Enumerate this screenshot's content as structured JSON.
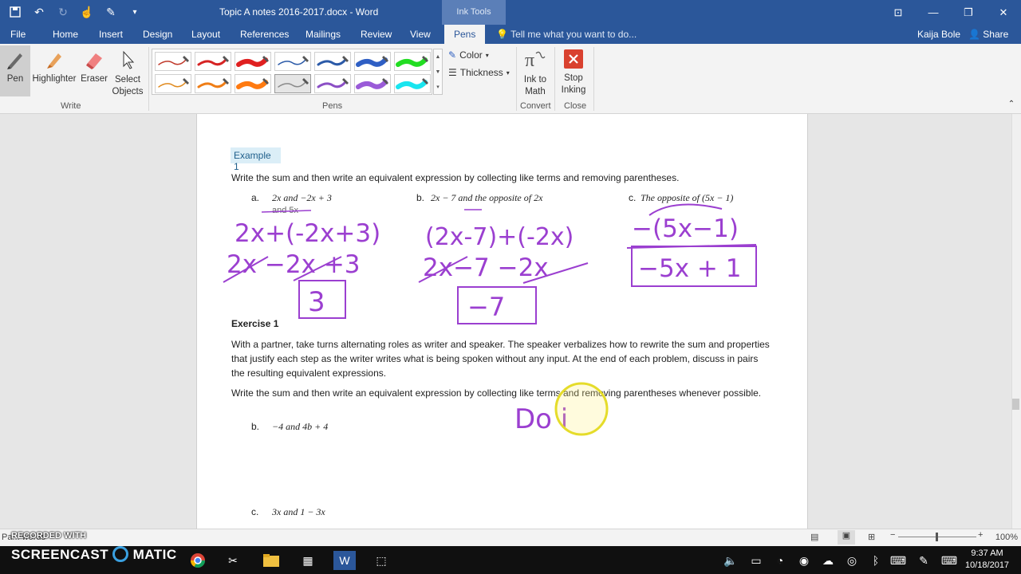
{
  "window": {
    "title": "Topic A notes 2016-2017.docx - Word",
    "ink_tools_label": "Ink Tools",
    "controls": [
      "⊡",
      "—",
      "❐",
      "✕"
    ]
  },
  "ribbon_tabs": [
    "File",
    "Home",
    "Insert",
    "Design",
    "Layout",
    "References",
    "Mailings",
    "Review",
    "View",
    "Pens"
  ],
  "active_tab": "Pens",
  "tell_me": "Tell me what you want to do...",
  "user_name": "Kaija Bole",
  "share_label": "Share",
  "ribbon": {
    "write_group": {
      "label": "Write",
      "pen": "Pen",
      "highlighter": "Highlighter",
      "eraser": "Eraser",
      "select_objects_1": "Select",
      "select_objects_2": "Objects"
    },
    "pens_group": {
      "label": "Pens",
      "row1_colors": [
        "#c0392b",
        "#d62424",
        "#e02020",
        "#2b5aa8",
        "#2b5aa8",
        "#2f5fc4",
        "#22dd22"
      ],
      "row2_colors": [
        "#e08a1e",
        "#ef7d16",
        "#ff7a10",
        "#8a8a8a",
        "#8b4fc5",
        "#9a5bd8",
        "#19e5ef"
      ],
      "color_cmd": "Color",
      "thickness_cmd": "Thickness"
    },
    "convert_group": {
      "label": "Convert",
      "ink_to_math_1": "Ink to",
      "ink_to_math_2": "Math"
    },
    "close_group": {
      "label": "Close",
      "stop_inking_1": "Stop",
      "stop_inking_2": "Inking"
    }
  },
  "document": {
    "example_label": "Example 1",
    "instruction1": "Write the sum and then write an equivalent expression by collecting like terms and removing parentheses.",
    "items_a": {
      "letter": "a.",
      "expr": "2x  and  −2x + 3",
      "note": "and 5x"
    },
    "items_b": {
      "letter": "b.",
      "expr": "2x − 7 and the opposite of 2x"
    },
    "items_c": {
      "letter": "c.",
      "expr": "The opposite of (5x − 1)"
    },
    "exercise_label": "Exercise 1",
    "exercise_para": "With a partner, take turns alternating roles as writer and speaker.  The speaker verbalizes how to rewrite the sum and properties that justify each step as the writer writes what is being spoken without any input.  At the end of each problem, discuss in pairs the resulting equivalent expressions.",
    "instruction2": "Write the sum and then write an equivalent expression by collecting like terms and removing parentheses whenever possible.",
    "ex_b": {
      "letter": "b.",
      "expr": "−4 and 4b + 4"
    },
    "ex_c": {
      "letter": "c.",
      "expr": "3x and 1 − 3x"
    }
  },
  "handwriting": {
    "a_line1": "2x+(-2x+3)",
    "a_line2": "2x −2x +3",
    "a_answer": "3",
    "b_line1": "(2x-7)+(-2x)",
    "b_line2": "2x−7 −2x",
    "b_answer": "−7",
    "c_line1": "−(5x−1)",
    "c_answer": "−5x + 1",
    "ex_b_ink": "Do i"
  },
  "status": {
    "page_words": "Pa... words",
    "recorded_with": "RECORDED WITH",
    "zoom": "100%"
  },
  "taskbar": {
    "screencast_label": "SCREENCAST",
    "matic_label": "MATIC",
    "time": "9:37 AM",
    "date": "10/18/2017"
  }
}
